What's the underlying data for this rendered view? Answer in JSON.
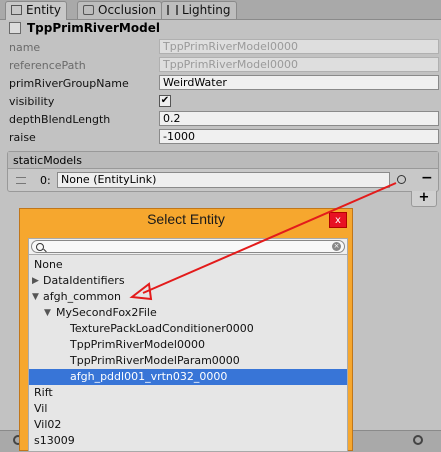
{
  "tabs": [
    {
      "label": "Entity",
      "icon": "entity-icon"
    },
    {
      "label": "Occlusion",
      "icon": "cube-icon"
    },
    {
      "label": "Lighting",
      "icon": "sliders-icon"
    }
  ],
  "component": {
    "title": "TppPrimRiverModel"
  },
  "properties": {
    "name": {
      "label": "name",
      "value": "TppPrimRiverModel0000"
    },
    "referencePath": {
      "label": "referencePath",
      "value": "TppPrimRiverModel0000"
    },
    "primRiverGroupName": {
      "label": "primRiverGroupName",
      "value": "WeirdWater"
    },
    "visibility": {
      "label": "visibility",
      "checked": true,
      "check_glyph": "✔"
    },
    "depthBlendLength": {
      "label": "depthBlendLength",
      "value": "0.2"
    },
    "raise": {
      "label": "raise",
      "value": "-1000"
    }
  },
  "staticModels": {
    "label": "staticModels",
    "items": [
      {
        "index": "0:",
        "value": "None (EntityLink)"
      }
    ],
    "remove_label": "−",
    "add_label": "+"
  },
  "dialog": {
    "title": "Select Entity",
    "close_label": "x",
    "search_placeholder": "",
    "tree": [
      {
        "label": "None",
        "depth": 0,
        "arrow": ""
      },
      {
        "label": "DataIdentifiers",
        "depth": 0,
        "arrow": "▶"
      },
      {
        "label": "afgh_common",
        "depth": 0,
        "arrow": "▼"
      },
      {
        "label": "MySecondFox2File",
        "depth": 1,
        "arrow": "▼"
      },
      {
        "label": "TexturePackLoadConditioner0000",
        "depth": 2,
        "arrow": ""
      },
      {
        "label": "TppPrimRiverModel0000",
        "depth": 2,
        "arrow": ""
      },
      {
        "label": "TppPrimRiverModelParam0000",
        "depth": 2,
        "arrow": ""
      },
      {
        "label": "afgh_pddl001_vrtn032_0000",
        "depth": 2,
        "arrow": "",
        "selected": true
      },
      {
        "label": "Rift",
        "depth": 0,
        "arrow": ""
      },
      {
        "label": "Vil",
        "depth": 0,
        "arrow": ""
      },
      {
        "label": "Vil02",
        "depth": 0,
        "arrow": ""
      },
      {
        "label": "s13009",
        "depth": 0,
        "arrow": ""
      }
    ]
  },
  "colors": {
    "dialog_bg": "#f6a72e",
    "selection": "#3875d7",
    "annotation_arrow": "#e31b1b",
    "close_button": "#e81123"
  }
}
